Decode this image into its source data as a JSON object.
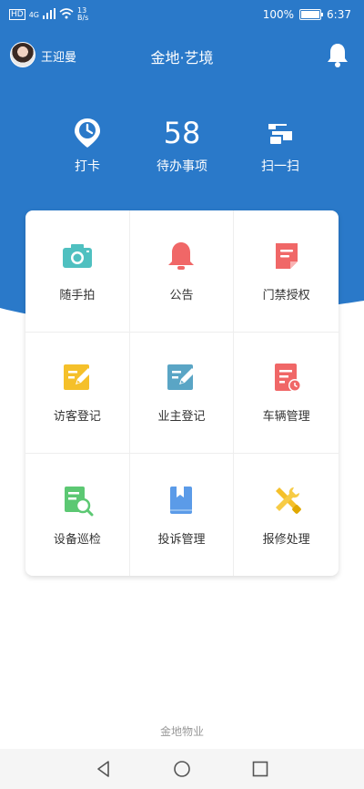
{
  "status": {
    "network": "HD",
    "signal": "4G",
    "speed_value": "13",
    "speed_unit": "B/s",
    "battery": "100%",
    "battery_level": 1.0,
    "time": "6:37"
  },
  "header": {
    "username": "王迎曼",
    "title": "金地·艺境"
  },
  "quick_actions": [
    {
      "label": "打卡",
      "icon": "clock-icon"
    },
    {
      "label": "待办事项",
      "value": "58"
    },
    {
      "label": "扫一扫",
      "icon": "scan-icon"
    }
  ],
  "grid": [
    {
      "label": "随手拍",
      "icon": "camera-icon",
      "color": "#4fc0c0"
    },
    {
      "label": "公告",
      "icon": "bell-icon",
      "color": "#f06767"
    },
    {
      "label": "门禁授权",
      "icon": "note-icon",
      "color": "#f06767"
    },
    {
      "label": "访客登记",
      "icon": "edit-icon",
      "color": "#f5c02a"
    },
    {
      "label": "业主登记",
      "icon": "edit-icon",
      "color": "#5aa5c5"
    },
    {
      "label": "车辆管理",
      "icon": "list-clock-icon",
      "color": "#f06767"
    },
    {
      "label": "设备巡检",
      "icon": "inspect-icon",
      "color": "#5cc873"
    },
    {
      "label": "投诉管理",
      "icon": "bookmark-book-icon",
      "color": "#5b9be8"
    },
    {
      "label": "报修处理",
      "icon": "tools-icon",
      "color": "#f5c02a"
    }
  ],
  "footer": "金地物业",
  "colors": {
    "primary": "#2a79c9"
  }
}
